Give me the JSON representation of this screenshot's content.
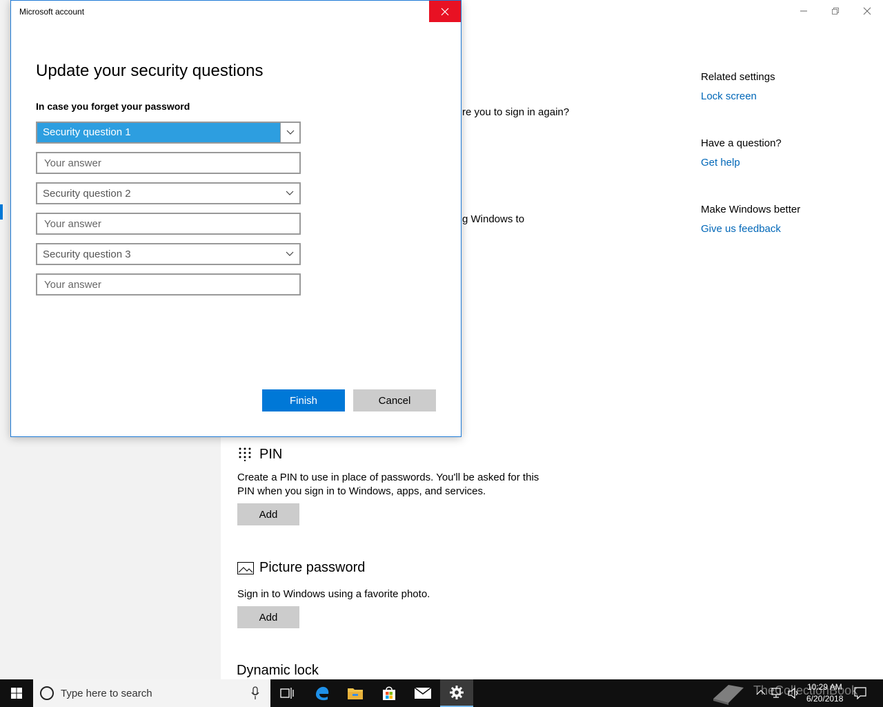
{
  "dialog": {
    "window_title": "Microsoft account",
    "heading": "Update your security questions",
    "subheading": "In case you forget your password",
    "questions": [
      {
        "label": "Security question 1",
        "answer_placeholder": "Your answer"
      },
      {
        "label": "Security question 2",
        "answer_placeholder": "Your answer"
      },
      {
        "label": "Security question 3",
        "answer_placeholder": "Your answer"
      }
    ],
    "finish_label": "Finish",
    "cancel_label": "Cancel"
  },
  "settings": {
    "fragment_1": "re you to sign in again?",
    "fragment_2": "g Windows to",
    "pin": {
      "title": "PIN",
      "description": "Create a PIN to use in place of passwords. You'll be asked for this PIN when you sign in to Windows, apps, and services.",
      "button": "Add"
    },
    "picture_password": {
      "title": "Picture password",
      "description": "Sign in to Windows using a favorite photo.",
      "button": "Add"
    },
    "dynamic_lock": {
      "title": "Dynamic lock"
    },
    "related": {
      "related_settings": "Related settings",
      "lock_screen": "Lock screen",
      "have_question": "Have a question?",
      "get_help": "Get help",
      "make_better": "Make Windows better",
      "feedback": "Give us feedback"
    }
  },
  "taskbar": {
    "search_placeholder": "Type here to search",
    "time": "10:29 AM",
    "date": "6/20/2018",
    "watermark": "TheCollectionBook"
  },
  "colors": {
    "accent": "#0078d7",
    "close_red": "#e81123",
    "link": "#0067b8",
    "selected_combo": "#2d9ee0"
  },
  "icons": {
    "start": "windows-logo-icon",
    "search": "cortana-circle-icon",
    "mic": "microphone-icon",
    "task_view": "task-view-icon",
    "edge": "edge-browser-icon",
    "explorer": "folder-icon",
    "store": "store-bag-icon",
    "mail": "mail-icon",
    "settings": "gear-icon"
  }
}
